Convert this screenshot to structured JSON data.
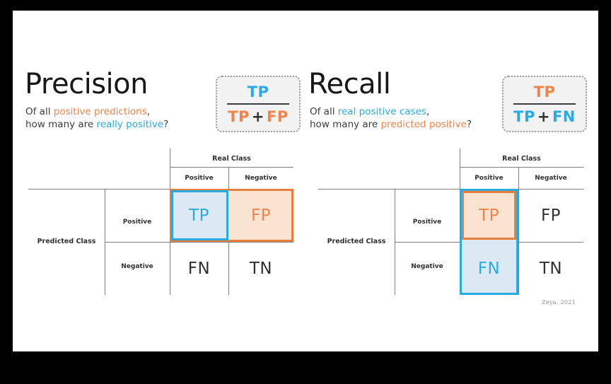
{
  "slide": {
    "background": "#ffffff",
    "frame_color": "#000000",
    "credit": "Zeya, 2021"
  },
  "colors": {
    "blue": "#29ABE2",
    "orange": "#F0844A",
    "blue_fill": "#DCE9F5",
    "orange_fill": "#FBE3D2",
    "orange_border": "#E8803C",
    "text_dark": "#2f3133",
    "line": "#7c7f83",
    "formula_bg": "#F2F2F2"
  },
  "precision": {
    "heading": "Precision",
    "subtitle": {
      "line1_prefix": "Of all ",
      "line1_highlight": "positive predictions",
      "line1_suffix": ",",
      "line2_prefix": "how many are ",
      "line2_highlight": "really positive",
      "line2_suffix": "?"
    },
    "formula": {
      "numerator": "TP",
      "denominator_left": "TP",
      "denominator_op": "+",
      "denominator_right": "FP"
    },
    "matrix": {
      "col_group_title": "Real Class",
      "row_group_title": "Predicted Class",
      "col_headers": [
        "Positive",
        "Negative"
      ],
      "row_headers": [
        "Positive",
        "Negative"
      ],
      "cells": [
        [
          "TP",
          "FP"
        ],
        [
          "FN",
          "TN"
        ]
      ]
    }
  },
  "recall": {
    "heading": "Recall",
    "subtitle": {
      "line1_prefix": "Of all ",
      "line1_highlight": "real positive cases",
      "line1_suffix": ",",
      "line2_prefix": "how many are ",
      "line2_highlight": "predicted positive",
      "line2_suffix": "?"
    },
    "formula": {
      "numerator": "TP",
      "denominator_left": "TP",
      "denominator_op": "+",
      "denominator_right": "FN"
    },
    "matrix": {
      "col_group_title": "Real Class",
      "row_group_title": "Predicted Class",
      "col_headers": [
        "Positive",
        "Negative"
      ],
      "row_headers": [
        "Positive",
        "Negative"
      ],
      "cells": [
        [
          "TP",
          "FP"
        ],
        [
          "FN",
          "TN"
        ]
      ]
    }
  }
}
